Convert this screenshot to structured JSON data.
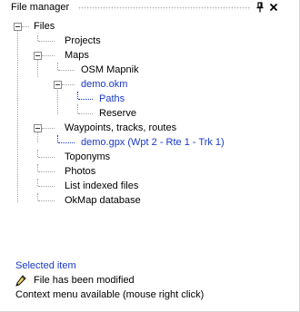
{
  "header": {
    "title": "File manager",
    "pin_glyph": "p",
    "close_glyph": "✕"
  },
  "tree": {
    "root": "Files",
    "projects": "Projects",
    "maps": "Maps",
    "osm_mapnik": "OSM Mapnik",
    "demo_okm": "demo.okm",
    "paths": "Paths",
    "reserve": "Reserve",
    "waypoints": "Waypoints, tracks, routes",
    "demo_gpx": "demo.gpx (Wpt 2 - Rte 1 - Trk 1)",
    "toponyms": "Toponyms",
    "photos": "Photos",
    "list_indexed": "List indexed files",
    "okmap_db": "OkMap database"
  },
  "legend": {
    "selected_item": "Selected item",
    "modified": "File has been modified",
    "context_menu": "Context menu available (mouse right click)"
  },
  "colors": {
    "selected": "#1a38c8",
    "text": "#000000"
  },
  "icons": {
    "pin": "pin-icon",
    "close": "close-icon",
    "modified": "pencil-icon"
  }
}
